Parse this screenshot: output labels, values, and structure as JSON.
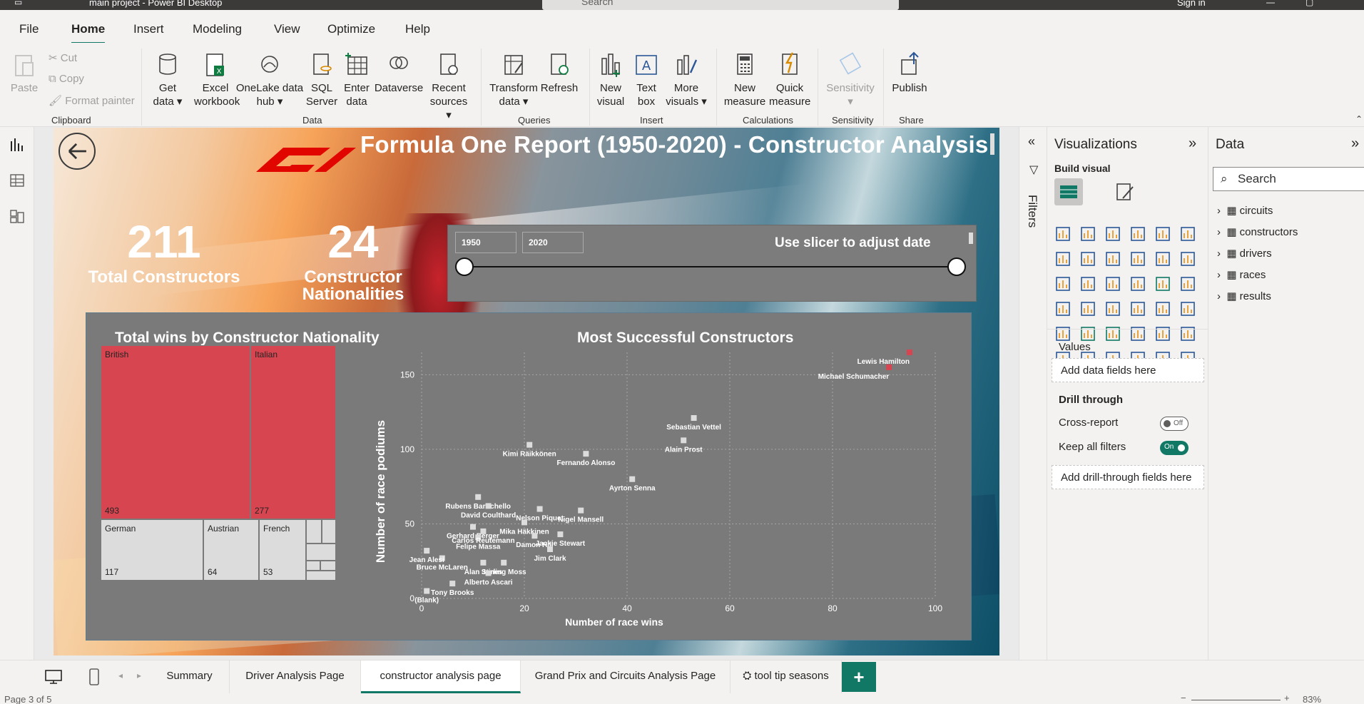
{
  "window": {
    "title": "main project - Power BI Desktop",
    "search_placeholder": "Search",
    "signin": "Sign in"
  },
  "menu": [
    "File",
    "Home",
    "Insert",
    "Modeling",
    "View",
    "Optimize",
    "Help"
  ],
  "ribbon": {
    "clipboard": {
      "paste": "Paste",
      "cut": "Cut",
      "copy": "Copy",
      "format_painter": "Format painter",
      "group": "Clipboard"
    },
    "data": {
      "get_data": "Get data",
      "excel": "Excel workbook",
      "onelake": "OneLake data hub",
      "sql": "SQL Server",
      "enter": "Enter data",
      "dataverse": "Dataverse",
      "recent": "Recent sources",
      "group": "Data"
    },
    "queries": {
      "transform": "Transform data",
      "refresh": "Refresh",
      "group": "Queries"
    },
    "insert": {
      "new_visual": "New visual",
      "text_box": "Text box",
      "more_visuals": "More visuals",
      "group": "Insert"
    },
    "calculations": {
      "new_measure": "New measure",
      "quick_measure": "Quick measure",
      "group": "Calculations"
    },
    "sensitivity": {
      "label": "Sensitivity",
      "group": "Sensitivity"
    },
    "share": {
      "publish": "Publish",
      "group": "Share"
    }
  },
  "report": {
    "title": "Formula One Report (1950-2020) - Constructor Analysis",
    "kpi1": {
      "value": "211",
      "label": "Total Constructors"
    },
    "kpi2": {
      "value": "24",
      "label": "Constructor Nationalities"
    },
    "slicer": {
      "start": "1950",
      "end": "2020",
      "title": "Use slicer to adjust date"
    },
    "treemap_title": "Total wins by Constructor Nationality",
    "treemap": [
      {
        "name": "British",
        "value": "493"
      },
      {
        "name": "Italian",
        "value": "277"
      },
      {
        "name": "German",
        "value": "117"
      },
      {
        "name": "Austrian",
        "value": "64"
      },
      {
        "name": "French",
        "value": "53"
      }
    ],
    "scatter_title": "Most Successful Constructors"
  },
  "chart_data": {
    "type": "scatter",
    "title": "Most Successful Constructors",
    "xlabel": "Number of race wins",
    "ylabel": "Number of race podiums",
    "xlim": [
      0,
      100
    ],
    "ylim": [
      0,
      165
    ],
    "xticks": [
      0,
      20,
      40,
      60,
      80,
      100
    ],
    "yticks": [
      0,
      50,
      100,
      150
    ],
    "grid": true,
    "points": [
      {
        "label": "Lewis Hamilton",
        "x": 95,
        "y": 165,
        "highlight": true
      },
      {
        "label": "Michael Schumacher",
        "x": 91,
        "y": 155,
        "highlight": true
      },
      {
        "label": "Sebastian Vettel",
        "x": 53,
        "y": 121
      },
      {
        "label": "Alain Prost",
        "x": 51,
        "y": 106
      },
      {
        "label": "Kimi Räikkönen",
        "x": 21,
        "y": 103
      },
      {
        "label": "Fernando Alonso",
        "x": 32,
        "y": 97
      },
      {
        "label": "Ayrton Senna",
        "x": 41,
        "y": 80
      },
      {
        "label": "Rubens Barrichello",
        "x": 11,
        "y": 68
      },
      {
        "label": "David Coulthard",
        "x": 13,
        "y": 62
      },
      {
        "label": "Nelson Piquet",
        "x": 23,
        "y": 60
      },
      {
        "label": "Mika Häkkinen",
        "x": 20,
        "y": 51
      },
      {
        "label": "Nigel Mansell",
        "x": 31,
        "y": 59
      },
      {
        "label": "Gerhard Berger",
        "x": 10,
        "y": 48
      },
      {
        "label": "Felipe Massa",
        "x": 11,
        "y": 41
      },
      {
        "label": "Damon Hill",
        "x": 22,
        "y": 42
      },
      {
        "label": "Carlos Reutemann",
        "x": 12,
        "y": 45
      },
      {
        "label": "Jackie Stewart",
        "x": 27,
        "y": 43
      },
      {
        "label": "Bruce McLaren",
        "x": 4,
        "y": 27
      },
      {
        "label": "Jim Clark",
        "x": 25,
        "y": 33
      },
      {
        "label": "Alan Jones",
        "x": 12,
        "y": 24
      },
      {
        "label": "Stirling Moss",
        "x": 16,
        "y": 24
      },
      {
        "label": "Alberto Ascari",
        "x": 13,
        "y": 17
      },
      {
        "label": "Tony Brooks",
        "x": 6,
        "y": 10
      },
      {
        "label": "(Blank)",
        "x": 1,
        "y": 5
      },
      {
        "label": "Jean Alesi",
        "x": 1,
        "y": 32
      }
    ]
  },
  "visualizations": {
    "header": "Visualizations",
    "build": "Build visual",
    "values": "Values",
    "add_fields": "Add data fields here",
    "drill": "Drill through",
    "cross_report": "Cross-report",
    "cross_state": "Off",
    "keep_filters": "Keep all filters",
    "keep_state": "On",
    "add_drill": "Add drill-through fields here"
  },
  "filters_label": "Filters",
  "data_pane": {
    "header": "Data",
    "search": "Search",
    "tables": [
      "circuits",
      "constructors",
      "drivers",
      "races",
      "results"
    ]
  },
  "tabs": [
    "Summary",
    "Driver Analysis Page",
    "constructor analysis page",
    "Grand Prix and Circuits Analysis Page",
    "tool tip seasons"
  ],
  "status": {
    "page": "Page 3 of 5",
    "zoom": "83%"
  },
  "colors": {
    "accent": "#117865",
    "treemap_red": "#d64550",
    "treemap_grey": "#dcdcdc"
  }
}
